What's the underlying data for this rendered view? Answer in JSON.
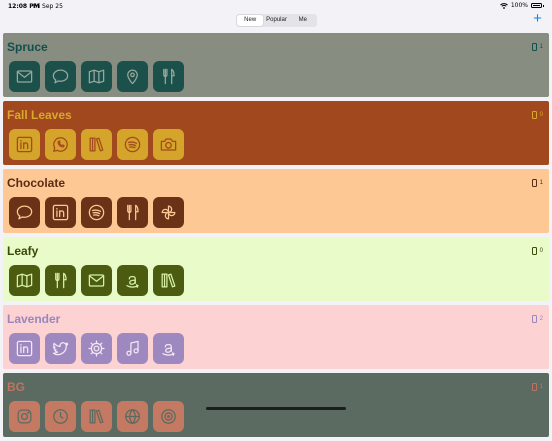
{
  "status": {
    "time": "12:08 PM",
    "date": "Fri Sep 25",
    "battery": "100%"
  },
  "tabs": [
    {
      "label": "New",
      "active": true
    },
    {
      "label": "Popular",
      "active": false
    },
    {
      "label": "Me",
      "active": false
    }
  ],
  "add_label": "+",
  "accent_color": "#0a84ff",
  "themes": [
    {
      "name": "Spruce",
      "count": "1",
      "bg": "#878d80",
      "fg": "#124f4b",
      "tile": "#1b504b",
      "glyph": "#9aa79b",
      "icons": [
        "mail-icon",
        "chat-bubble-icon",
        "map-icon",
        "location-pin-icon",
        "fork-knife-icon"
      ]
    },
    {
      "name": "Fall Leaves",
      "count": "0",
      "bg": "#a1481f",
      "fg": "#d8a92a",
      "tile": "#d4a52a",
      "glyph": "#a5491f",
      "icons": [
        "linkedin-icon",
        "whatsapp-icon",
        "books-icon",
        "spotify-icon",
        "camera-icon"
      ]
    },
    {
      "name": "Chocolate",
      "count": "1",
      "bg": "#fdc894",
      "fg": "#5a2c14",
      "tile": "#6a3217",
      "glyph": "#fdc894",
      "icons": [
        "chat-bubble-icon",
        "linkedin-icon",
        "spotify-icon",
        "fork-knife-icon",
        "pinwheel-icon"
      ]
    },
    {
      "name": "Leafy",
      "count": "0",
      "bg": "#e8fbc8",
      "fg": "#3a4a0a",
      "tile": "#4b5b10",
      "glyph": "#d7f0a8",
      "icons": [
        "map-icon",
        "fork-knife-icon",
        "mail-icon",
        "amazon-icon",
        "books-icon"
      ]
    },
    {
      "name": "Lavender",
      "count": "2",
      "bg": "#fcd2d2",
      "fg": "#9a86bd",
      "tile": "#9d88bf",
      "glyph": "#f4e6f2",
      "icons": [
        "linkedin-icon",
        "twitter-icon",
        "gear-icon",
        "music-note-icon",
        "amazon-icon"
      ]
    },
    {
      "name": "BG",
      "count": "1",
      "bg": "#5c6b61",
      "fg": "#c07460",
      "tile": "#c47a62",
      "glyph": "#5c6b61",
      "icons": [
        "instagram-icon",
        "clock-icon",
        "books-icon",
        "globe-icon",
        "target-icon"
      ]
    }
  ]
}
